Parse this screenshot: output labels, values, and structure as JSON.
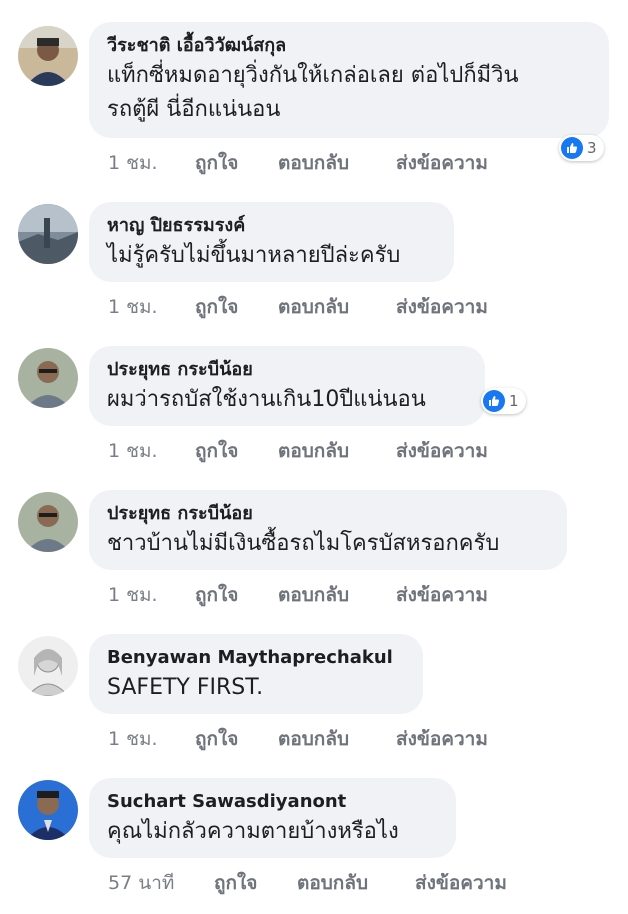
{
  "comments": [
    {
      "author": "วีระชาติ เอื้อวิวัฒน์สกุล",
      "text": "แท็กซี่หมดอายุวิ่งกันให้เกล่อเลย ต่อไปก็มีวิน\nรถตู้ผี นี่อีกแน่นอน",
      "time": "1 ชม.",
      "like": "ถูกใจ",
      "reply": "ตอบกลับ",
      "message": "ส่งข้อความ",
      "reactions": "3"
    },
    {
      "author": "หาญ ปิยธรรมรงค์",
      "text": "ไม่รู้ครับไม่ขึ้นมาหลายปีล่ะครับ",
      "time": "1 ชม.",
      "like": "ถูกใจ",
      "reply": "ตอบกลับ",
      "message": "ส่งข้อความ"
    },
    {
      "author": "ประยุทธ กระบีน้อย",
      "text": "ผมว่ารถบัสใช้งานเกิน10ปีแน่นอน",
      "time": "1 ชม.",
      "like": "ถูกใจ",
      "reply": "ตอบกลับ",
      "message": "ส่งข้อความ",
      "reactions": "1"
    },
    {
      "author": "ประยุทธ กระบีน้อย",
      "text": "ชาวบ้านไม่มีเงินซื้อรถไมโครบัสหรอกครับ",
      "time": "1 ชม.",
      "like": "ถูกใจ",
      "reply": "ตอบกลับ",
      "message": "ส่งข้อความ"
    },
    {
      "author": "Benyawan Maythaprechakul",
      "text": "SAFETY FIRST.",
      "time": "1 ชม.",
      "like": "ถูกใจ",
      "reply": "ตอบกลับ",
      "message": "ส่งข้อความ"
    },
    {
      "author": "Suchart Sawasdiyanont",
      "text": "คุณไม่กลัวความตายบ้างหรือไง",
      "time": "57 นาที",
      "like": "ถูกใจ",
      "reply": "ตอบกลับ",
      "message": "ส่งข้อความ"
    }
  ],
  "colors": {
    "bubble": "#f0f2f5",
    "like_blue": "#1877f2",
    "meta_gray": "#7a7f87"
  },
  "icons": {
    "reaction": "like-icon",
    "avatar": "avatar"
  }
}
